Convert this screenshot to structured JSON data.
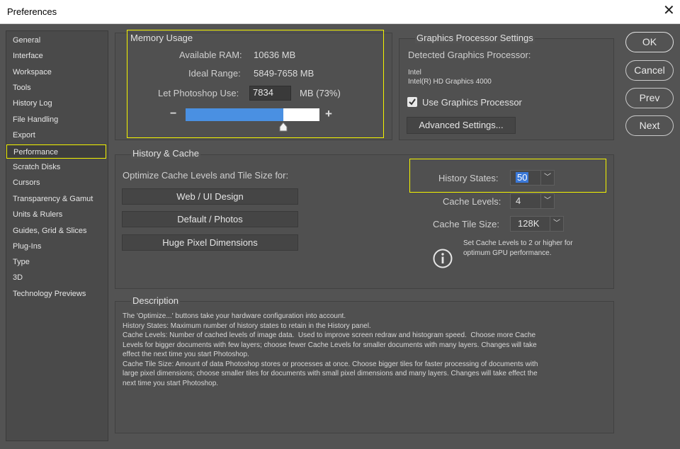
{
  "window": {
    "title": "Preferences",
    "close_glyph": "✕"
  },
  "sidebar": {
    "active": "Performance",
    "items": [
      "General",
      "Interface",
      "Workspace",
      "Tools",
      "History Log",
      "File Handling",
      "Export",
      "Performance",
      "Scratch Disks",
      "Cursors",
      "Transparency & Gamut",
      "Units & Rulers",
      "Guides, Grid & Slices",
      "Plug-Ins",
      "Type",
      "3D",
      "Technology Previews"
    ]
  },
  "memory": {
    "title": "Memory Usage",
    "available_label": "Available RAM:",
    "available_value": "10636 MB",
    "ideal_label": "Ideal Range:",
    "ideal_value": "5849-7658 MB",
    "let_label": "Let Photoshop Use:",
    "let_value": "7834",
    "let_unit": "MB (73%)",
    "minus": "−",
    "plus": "+",
    "slider_fraction": 0.73,
    "slider_color": "#4a90e2"
  },
  "gpu": {
    "title": "Graphics Processor Settings",
    "detected_label": "Detected Graphics Processor:",
    "vendor": "Intel",
    "model": "Intel(R) HD Graphics 4000",
    "use_label": "Use Graphics Processor",
    "use_checked": true,
    "advanced_button": "Advanced Settings..."
  },
  "history_cache": {
    "title": "History & Cache",
    "optimize_label": "Optimize Cache Levels and Tile Size for:",
    "buttons": [
      "Web / UI Design",
      "Default / Photos",
      "Huge Pixel Dimensions"
    ],
    "history_states_label": "History States:",
    "history_states_value": "50",
    "cache_levels_label": "Cache Levels:",
    "cache_levels_value": "4",
    "tile_size_label": "Cache Tile Size:",
    "tile_size_value": "128K",
    "info_line1": "Set Cache Levels to 2 or higher for",
    "info_line2": "optimum GPU performance."
  },
  "description": {
    "title": "Description",
    "lines": [
      "The 'Optimize...' buttons take your hardware configuration into account.",
      "History States: Maximum number of history states to retain in the History panel.",
      "Cache Levels: Number of cached levels of image data.  Used to improve screen redraw and histogram speed.  Choose more Cache",
      "Levels for bigger documents with few layers; choose fewer Cache Levels for smaller documents with many layers. Changes will take",
      "effect the next time you start Photoshop.",
      "Cache Tile Size: Amount of data Photoshop stores or processes at once. Choose bigger tiles for faster processing of documents with",
      "large pixel dimensions; choose smaller tiles for documents with small pixel dimensions and many layers. Changes will take effect the",
      "next time you start Photoshop."
    ]
  },
  "actions": {
    "ok": "OK",
    "cancel": "Cancel",
    "prev": "Prev",
    "next": "Next"
  },
  "colors": {
    "highlight": "#f4f400",
    "panel": "#535353"
  }
}
